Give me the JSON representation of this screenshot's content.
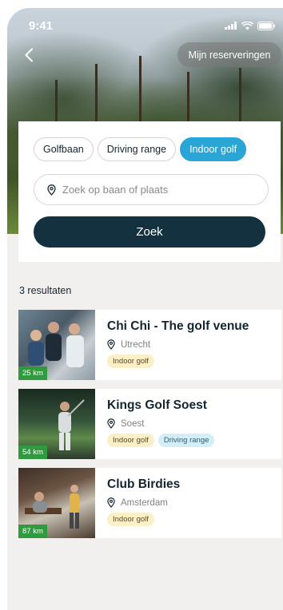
{
  "status_bar": {
    "time": "9:41"
  },
  "header": {
    "reservations_label": "Mijn reserveringen"
  },
  "filters": {
    "chips": [
      {
        "label": "Golfbaan",
        "active": false
      },
      {
        "label": "Driving range",
        "active": false
      },
      {
        "label": "Indoor golf",
        "active": true
      }
    ],
    "search_placeholder": "Zoek op baan of plaats",
    "search_button_label": "Zoek"
  },
  "results": {
    "count_label": "3 resultaten",
    "items": [
      {
        "title": "Chi Chi - The golf venue",
        "location": "Utrecht",
        "distance": "25 km",
        "tags": [
          "Indoor golf"
        ]
      },
      {
        "title": "Kings Golf Soest",
        "location": "Soest",
        "distance": "54 km",
        "tags": [
          "Indoor golf",
          "Driving range"
        ]
      },
      {
        "title": "Club Birdies",
        "location": "Amsterdam",
        "distance": "87 km",
        "tags": [
          "Indoor golf"
        ]
      }
    ]
  },
  "colors": {
    "accent": "#2aa6d6",
    "primary_dark": "#13313f",
    "distance_badge": "#2f9b3e"
  }
}
